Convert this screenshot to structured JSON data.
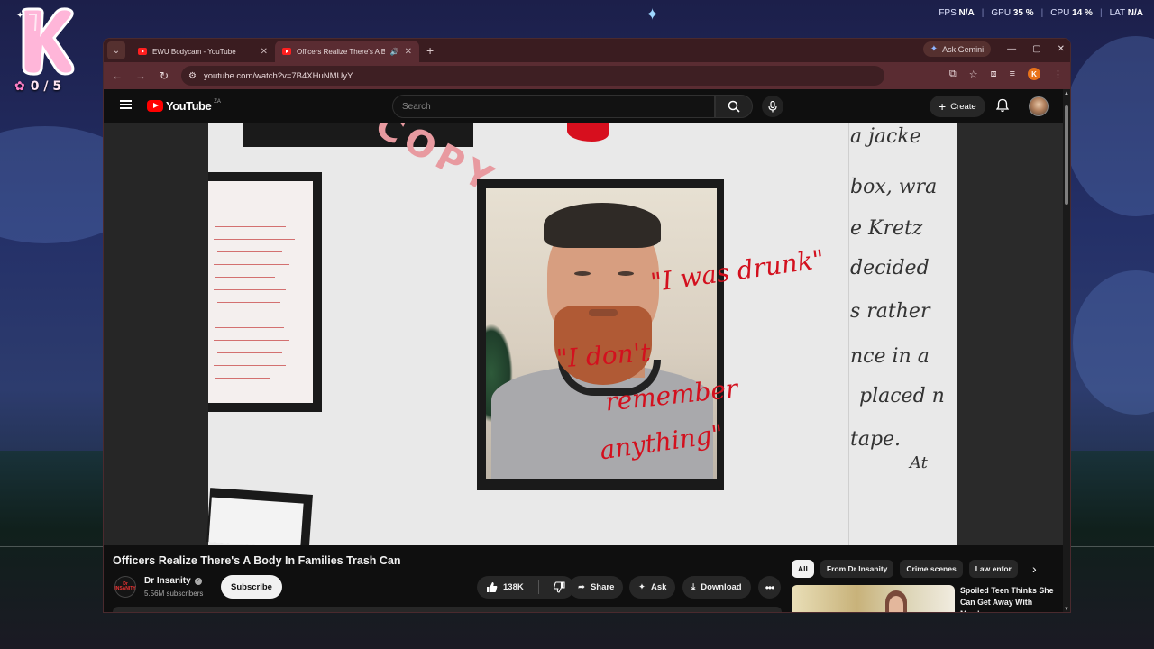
{
  "overlay": {
    "logo_letter": "K",
    "counter": "0 / 5",
    "perf": [
      {
        "label": "FPS",
        "value": "N/A"
      },
      {
        "label": "GPU",
        "value": "35 %"
      },
      {
        "label": "CPU",
        "value": "14 %"
      },
      {
        "label": "LAT",
        "value": "N/A"
      }
    ]
  },
  "browser": {
    "tabs": [
      {
        "title": "EWU Bodycam - YouTube",
        "active": false
      },
      {
        "title": "Officers Realize There's A B",
        "active": true
      }
    ],
    "gemini_label": "Ask Gemini",
    "url": "youtube.com/watch?v=7B4XHuNMUyY",
    "profile_initial": "K"
  },
  "youtube": {
    "logo_text": "YouTube",
    "region": "ZA",
    "search_placeholder": "Search",
    "create_label": "Create"
  },
  "video": {
    "title": "Officers Realize There's A Body In Families Trash Can",
    "overlay_text": {
      "quote1": "\"I was drunk\"",
      "quote2_line1": "\"I don't",
      "quote2_line2": "remember",
      "quote2_line3": "anything\"",
      "stamp": "COPY",
      "handwriting": [
        "a jacke",
        "box, wra",
        "e Kretz",
        "decided",
        "s rather",
        "nce in a",
        "placed n",
        "tape.",
        "At"
      ]
    }
  },
  "channel": {
    "name": "Dr Insanity",
    "avatar_text": "Dr INSANITY",
    "subscribers": "5.56M subscribers",
    "subscribe_label": "Subscribe"
  },
  "actions": {
    "likes": "138K",
    "share": "Share",
    "ask": "Ask",
    "download": "Download"
  },
  "sidebar": {
    "chips": [
      "All",
      "From Dr Insanity",
      "Crime scenes",
      "Law enfor"
    ],
    "rec_title": "Spoiled Teen Thinks She Can Get Away With Murder"
  }
}
